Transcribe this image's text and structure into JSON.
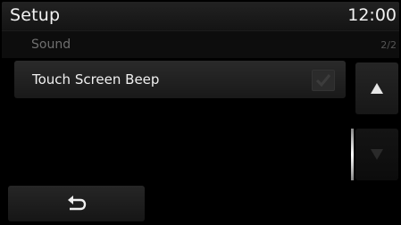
{
  "header": {
    "title": "Setup",
    "clock": "12:00"
  },
  "subheader": {
    "title": "Sound",
    "page_indicator": "2/2"
  },
  "list": {
    "items": [
      {
        "label": "Touch Screen Beep",
        "checked": true
      }
    ]
  },
  "scroll": {
    "up_icon": "triangle-up-icon",
    "down_icon": "triangle-down-icon"
  },
  "footer": {
    "back_icon": "back-arrow-icon"
  }
}
